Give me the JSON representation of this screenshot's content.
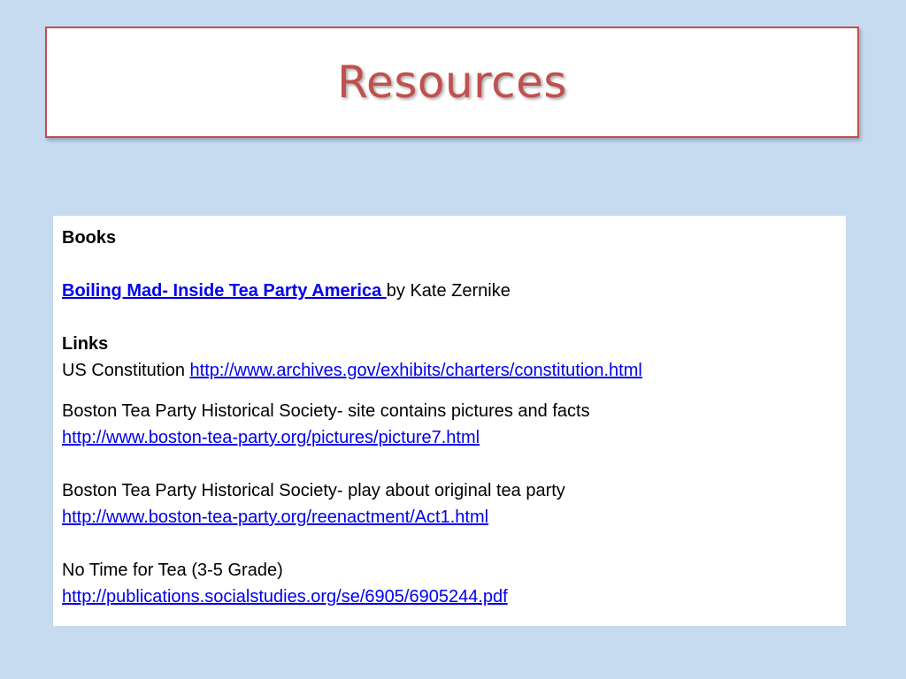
{
  "slide": {
    "title": "Resources"
  },
  "books": {
    "heading": "Books",
    "book_title": "Boiling Mad- Inside Tea Party America ",
    "book_author": "by Kate Zernike"
  },
  "links": {
    "heading": "Links",
    "items": [
      {
        "label": "US Constitution ",
        "url": "http://www.archives.gov/exhibits/charters/constitution.html"
      },
      {
        "label": "Boston Tea Party Historical Society- site contains pictures and facts",
        "url": "http://www.boston-tea-party.org/pictures/picture7.html"
      },
      {
        "label": "Boston Tea Party Historical Society- play about original tea party",
        "url": "http://www.boston-tea-party.org/reenactment/Act1.html"
      },
      {
        "label": "No Time for Tea (3-5 Grade)",
        "url": "http://publications.socialstudies.org/se/6905/6905244.pdf"
      }
    ]
  },
  "colors": {
    "background": "#c6daf0",
    "title": "#c0504d",
    "link": "#0000ee"
  }
}
